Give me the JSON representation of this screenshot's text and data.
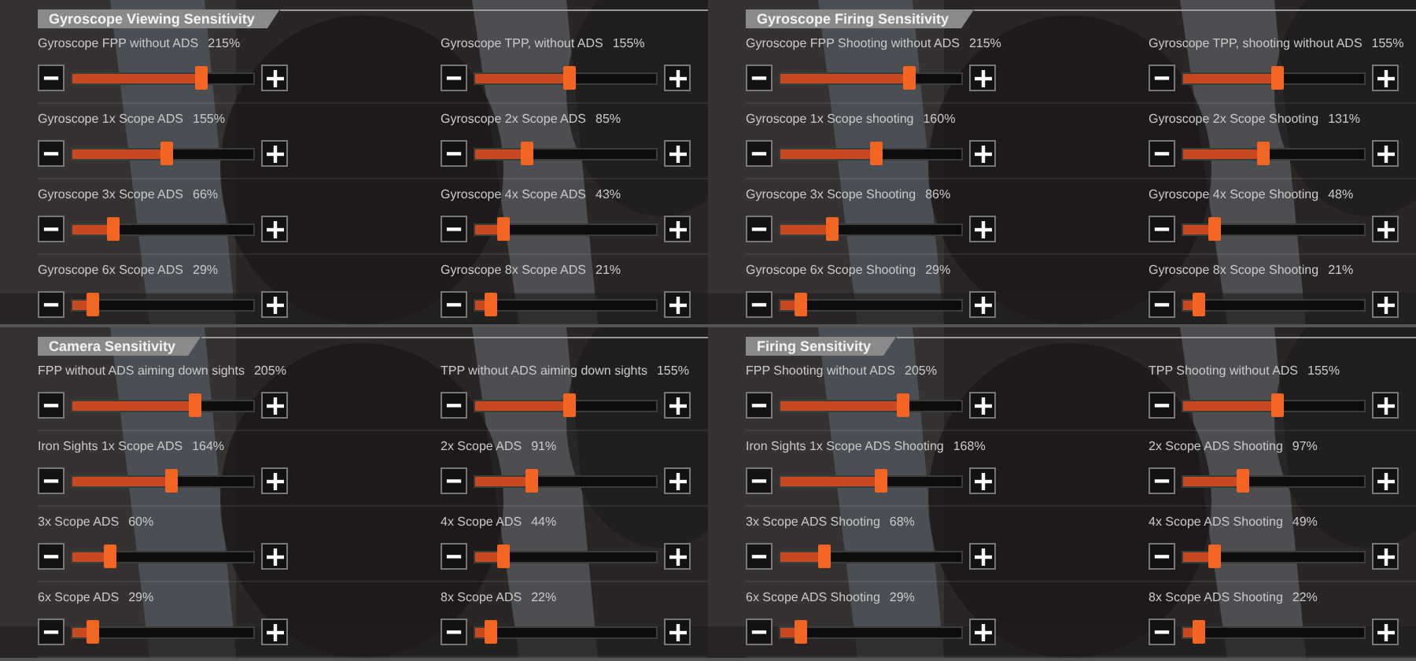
{
  "panels": [
    {
      "title": "Gyroscope Viewing Sensitivity",
      "settings": [
        {
          "label": "Gyroscope FPP without ADS",
          "value": "215%",
          "level": 0.71
        },
        {
          "label": "Gyroscope TPP, without ADS",
          "value": "155%",
          "level": 0.52
        },
        {
          "label": "Gyroscope 1x Scope ADS",
          "value": "155%",
          "level": 0.52
        },
        {
          "label": "Gyroscope 2x Scope ADS",
          "value": "85%",
          "level": 0.29
        },
        {
          "label": "Gyroscope 3x Scope ADS",
          "value": "66%",
          "level": 0.23
        },
        {
          "label": "Gyroscope 4x Scope ADS",
          "value": "43%",
          "level": 0.16
        },
        {
          "label": "Gyroscope 6x Scope ADS",
          "value": "29%",
          "level": 0.11
        },
        {
          "label": "Gyroscope 8x Scope ADS",
          "value": "21%",
          "level": 0.09
        }
      ]
    },
    {
      "title": "Gyroscope Firing Sensitivity",
      "settings": [
        {
          "label": "Gyroscope FPP Shooting without ADS",
          "value": "215%",
          "level": 0.71
        },
        {
          "label": "Gyroscope TPP, shooting without ADS",
          "value": "155%",
          "level": 0.52
        },
        {
          "label": "Gyroscope 1x Scope shooting",
          "value": "160%",
          "level": 0.53
        },
        {
          "label": "Gyroscope 2x Scope Shooting",
          "value": "131%",
          "level": 0.44
        },
        {
          "label": "Gyroscope 3x Scope Shooting",
          "value": "86%",
          "level": 0.29
        },
        {
          "label": "Gyroscope 4x Scope Shooting",
          "value": "48%",
          "level": 0.17
        },
        {
          "label": "Gyroscope 6x Scope Shooting",
          "value": "29%",
          "level": 0.11
        },
        {
          "label": "Gyroscope 8x Scope Shooting",
          "value": "21%",
          "level": 0.09
        }
      ]
    },
    {
      "title": "Camera Sensitivity",
      "settings": [
        {
          "label": "FPP without ADS aiming down sights",
          "value": "205%",
          "level": 0.68
        },
        {
          "label": "TPP without ADS aiming down sights",
          "value": "155%",
          "level": 0.52
        },
        {
          "label": "Iron Sights 1x Scope ADS",
          "value": "164%",
          "level": 0.55
        },
        {
          "label": "2x Scope ADS",
          "value": "91%",
          "level": 0.31
        },
        {
          "label": "3x Scope ADS",
          "value": "60%",
          "level": 0.21
        },
        {
          "label": "4x Scope ADS",
          "value": "44%",
          "level": 0.16
        },
        {
          "label": "6x Scope ADS",
          "value": "29%",
          "level": 0.11
        },
        {
          "label": "8x Scope ADS",
          "value": "22%",
          "level": 0.09
        }
      ]
    },
    {
      "title": "Firing Sensitivity",
      "settings": [
        {
          "label": "FPP Shooting without ADS",
          "value": "205%",
          "level": 0.68
        },
        {
          "label": "TPP Shooting without ADS",
          "value": "155%",
          "level": 0.52
        },
        {
          "label": "Iron Sights 1x Scope ADS Shooting",
          "value": "168%",
          "level": 0.56
        },
        {
          "label": "2x Scope ADS Shooting",
          "value": "97%",
          "level": 0.33
        },
        {
          "label": "3x Scope ADS Shooting",
          "value": "68%",
          "level": 0.24
        },
        {
          "label": "4x Scope ADS Shooting",
          "value": "49%",
          "level": 0.17
        },
        {
          "label": "6x Scope ADS Shooting",
          "value": "29%",
          "level": 0.11
        },
        {
          "label": "8x Scope ADS Shooting",
          "value": "22%",
          "level": 0.09
        }
      ]
    }
  ]
}
